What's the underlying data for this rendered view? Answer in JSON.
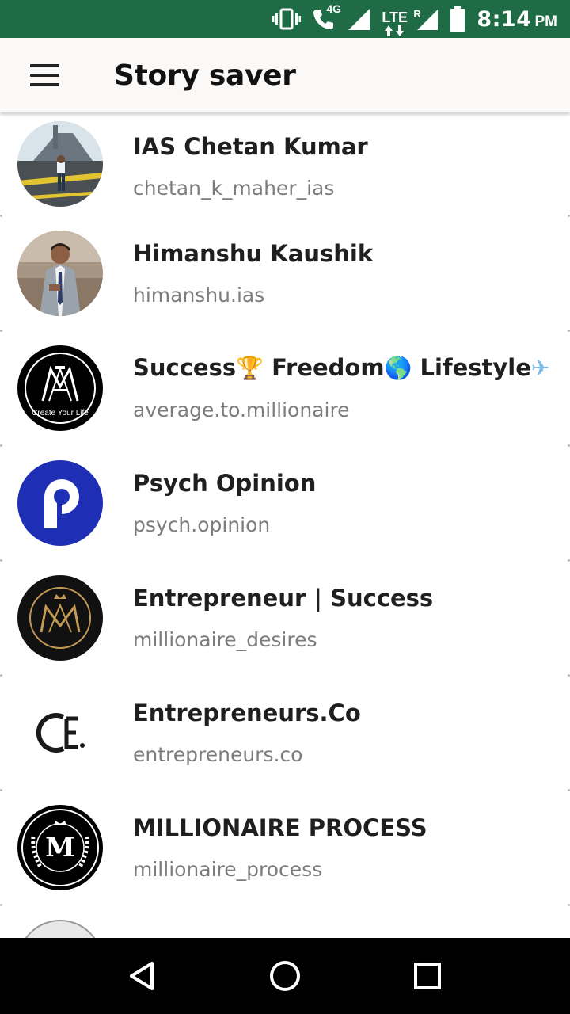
{
  "status_bar": {
    "network_label": "4G",
    "lte_label": "LTE",
    "roaming_label": "R",
    "time": "8:14",
    "ampm": "PM",
    "background_color": "#1e6b45"
  },
  "app_bar": {
    "menu_icon": "hamburger-menu-icon",
    "title": "Story saver"
  },
  "accounts": [
    {
      "name": "IAS Chetan Kumar",
      "handle": "chetan_k_maher_ias",
      "avatar": "photo-man-on-aircraft-carrier"
    },
    {
      "name": "Himanshu Kaushik",
      "handle": "himanshu.ias",
      "avatar": "photo-man-in-suit"
    },
    {
      "name_parts": [
        "Success",
        "🏆",
        " Freedom",
        "🌎",
        "  Lifestyle",
        "✈"
      ],
      "handle": "average.to.millionaire",
      "avatar_logo_text": "Create Your Life",
      "avatar": "logo-ma-monogram"
    },
    {
      "name": "Psych Opinion",
      "handle": "psych.opinion",
      "avatar": "logo-letter-p-blue"
    },
    {
      "name": "Entrepreneur | Success",
      "handle": "millionaire_desires",
      "avatar": "logo-gold-m-crown"
    },
    {
      "name": "Entrepreneurs.Co",
      "handle": "entrepreneurs.co",
      "avatar": "logo-ce"
    },
    {
      "name": "MILLIONAIRE PROCESS",
      "handle": "millionaire_process",
      "avatar_logo_text": "M",
      "avatar": "logo-m-laurel"
    }
  ],
  "nav_bar": {
    "back_icon": "back-triangle-icon",
    "home_icon": "home-circle-icon",
    "recents_icon": "recents-square-icon"
  }
}
